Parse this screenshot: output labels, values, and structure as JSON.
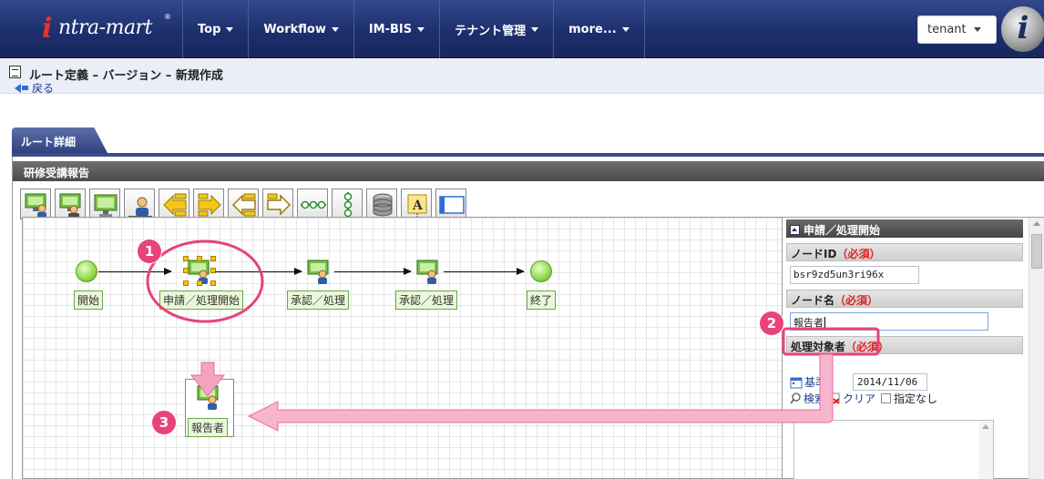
{
  "topbar": {
    "logo_i": "i",
    "logo_text": "ntra-mart",
    "logo_reg": "®",
    "nav": [
      "Top",
      "Workflow",
      "IM-BIS",
      "テナント管理",
      "more..."
    ],
    "tenant_label": "tenant",
    "brand_icon": "i"
  },
  "title_band": {
    "page_title": "ルート定義 – バージョン – 新規作成",
    "back_label": "戻る"
  },
  "tab_label": "ルート詳細",
  "panel": {
    "header": "研修受講報告",
    "toolbar_icons": [
      "apply-node-icon",
      "approve-node-icon",
      "process-node-icon",
      "person-node-icon",
      "branch-node-icon",
      "join-node-icon",
      "branch-outline-icon",
      "join-outline-icon",
      "horizontal-join-icon",
      "vertical-join-icon",
      "database-icon",
      "text-node-icon",
      "frame-icon"
    ],
    "nodes": {
      "start": "開始",
      "apply": "申請／処理開始",
      "approve1": "承認／処理",
      "approve2": "承認／処理",
      "end": "終了",
      "reporter": "報告者"
    }
  },
  "properties": {
    "section_title": "申請／処理開始",
    "node_id_label": "ノードID",
    "node_id_required": "（必須）",
    "node_id_value": "bsr9zd5un3ri96x",
    "node_name_label": "ノード名",
    "node_name_required": "（必須）",
    "node_name_value": "報告者",
    "target_label": "処理対象者",
    "target_required": "（必須）",
    "base_label": "基準",
    "base_date": "2014/11/06",
    "search_label": "検索",
    "clear_label": "クリア",
    "no_spec_label": "指定なし"
  },
  "annotations": {
    "badge1": "1",
    "badge2": "2",
    "badge3": "3",
    "accent_color": "#e8437a"
  }
}
